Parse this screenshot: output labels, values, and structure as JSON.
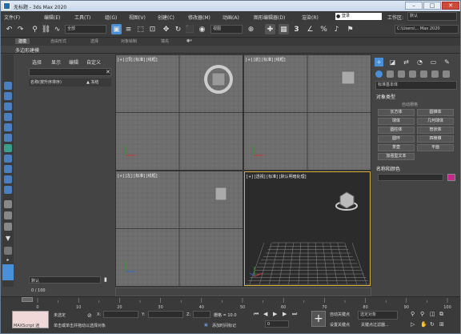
{
  "window": {
    "title": "无标题 - 3ds Max 2020"
  },
  "titlebar_buttons": {
    "minimize": "–",
    "maximize": "□",
    "close": "✕"
  },
  "menu": [
    {
      "label": "文件(F)"
    },
    {
      "label": "编辑(E)"
    },
    {
      "label": "工具(T)"
    },
    {
      "label": "组(G)"
    },
    {
      "label": "视图(V)"
    },
    {
      "label": "创建(C)"
    },
    {
      "label": "修改器(M)"
    },
    {
      "label": "动画(A)"
    },
    {
      "label": "图形编辑器(D)"
    },
    {
      "label": "渲染(R)"
    }
  ],
  "account": {
    "label": "登录",
    "workspace_label": "工作区:",
    "workspace_value": "默认"
  },
  "toolbar": {
    "selection_filter": "全部",
    "coordinate_system": "视图",
    "project_path": "C:\\Users\\... Max 2020",
    "icons": {
      "undo": "↶",
      "redo": "↷",
      "link": "⚲",
      "unlink": "⛓",
      "bind": "∿",
      "select": "▣",
      "select_by_name": "≡",
      "rect_select": "⬚",
      "window_crossing": "⊡",
      "move": "✥",
      "rotate": "↻",
      "scale": "⬛",
      "place": "◉",
      "pivot": "⊕",
      "snap": "3",
      "angle_snap": "∠",
      "percent_snap": "%",
      "spinner_snap": "♪",
      "named_sets": "⚑"
    }
  },
  "ribbon": {
    "tabs": [
      "建模",
      "自由形式",
      "选择",
      "对象绘制",
      "填充"
    ],
    "sublabel": "多边形建模"
  },
  "scene_explorer": {
    "tabs": [
      "选择",
      "显示",
      "编辑",
      "自定义"
    ],
    "column_name": "名称(按升序排序)",
    "column_frozen": "▲ 冻结",
    "close": "✕"
  },
  "layer_bar": {
    "label": "默认"
  },
  "viewports": {
    "top": {
      "label": "[+] [顶] [标准] [线框]"
    },
    "front": {
      "label": "[+] [前] [标准] [线框]"
    },
    "left": {
      "label": "[+] [左] [标准] [线框]"
    },
    "persp": {
      "label": "[+] [透视] [标准] [默认明暗处理]"
    }
  },
  "command_panel": {
    "tab_icons": {
      "create": "+",
      "modify": "◪",
      "hierarchy": "⇄",
      "motion": "◔",
      "display": "▭",
      "utilities": "✎"
    },
    "category_dropdown": "标准基本体",
    "object_type_header": "对象类型",
    "autogrid": "自动栅格",
    "buttons": [
      "长方体",
      "圆锥体",
      "球体",
      "几何球体",
      "圆柱体",
      "管状体",
      "圆环",
      "四棱锥",
      "茶壶",
      "平面",
      "加强型文本"
    ],
    "name_color_header": "名称和颜色",
    "object_color": "#c8288c"
  },
  "timeline": {
    "counter": "0 / 100",
    "ticks": [
      "0",
      "10",
      "20",
      "30",
      "40",
      "50",
      "60",
      "70",
      "80",
      "90",
      "100"
    ]
  },
  "status": {
    "script_label": "MAXScript 迷",
    "selection": "未选定",
    "prompt": "单击或单击并拖动以选择对象",
    "x_label": "X:",
    "y_label": "Y:",
    "z_label": "Z:",
    "grid_label": "栅格 = 10.0",
    "add_time_tag": "添加时间标记",
    "auto_key": "自动关键点",
    "selected_set": "选定对象",
    "set_key": "设置关键点",
    "key_filters": "关键点过滤器...",
    "frame": "0"
  },
  "colors": {
    "accent": "#4a90d9",
    "create_button_bg": "#3a5f8c",
    "viewport_bg": "#707070"
  }
}
